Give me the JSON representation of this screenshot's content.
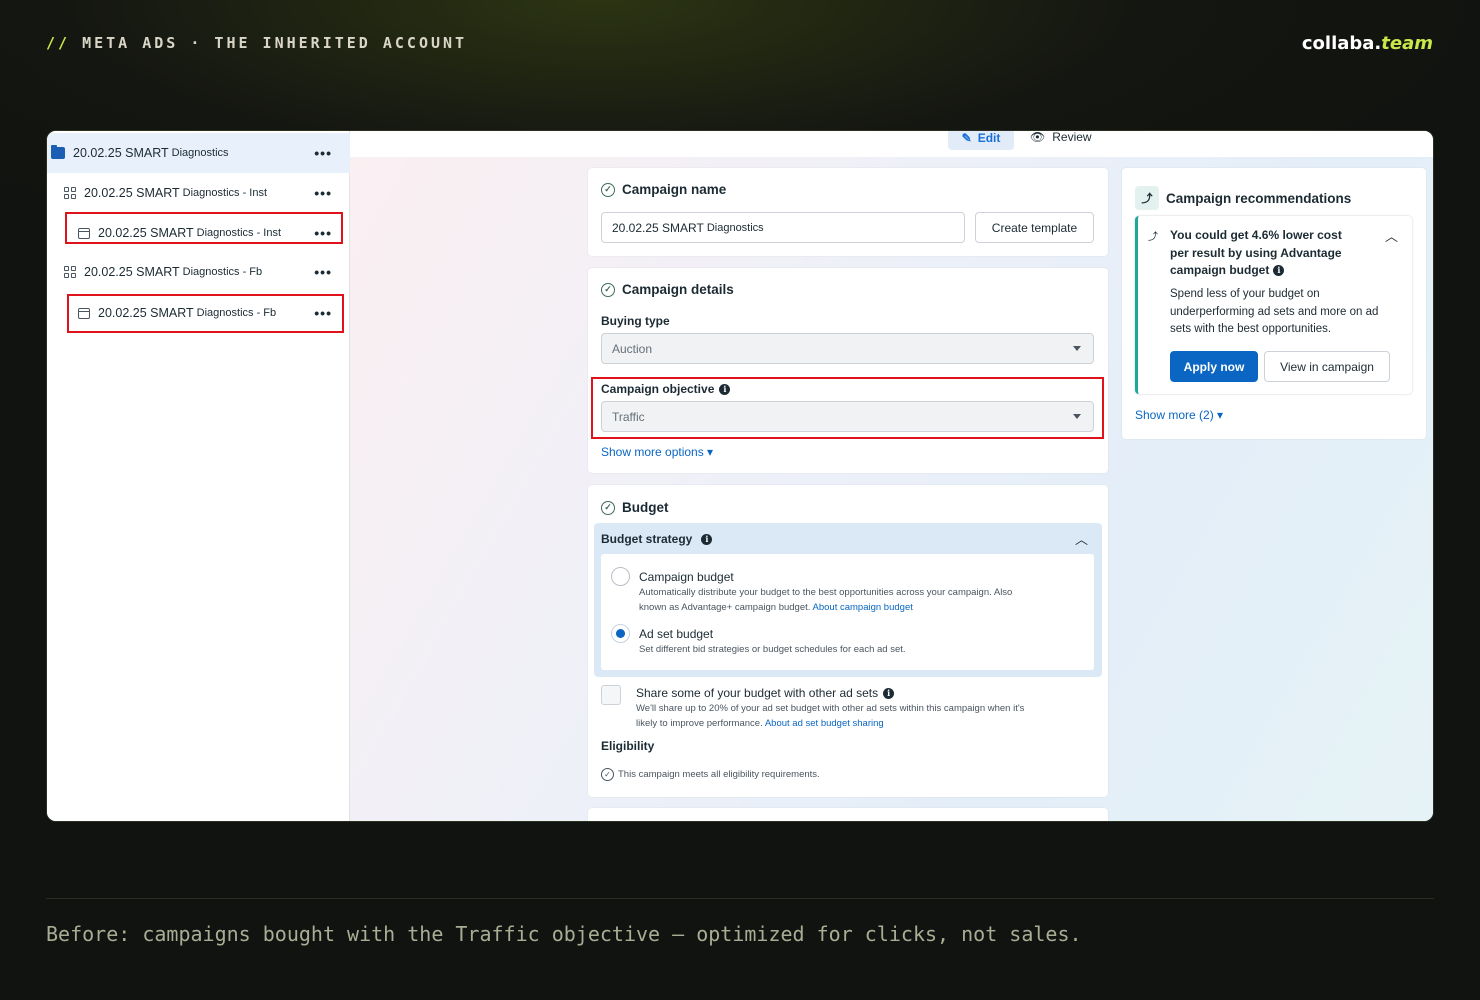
{
  "header": {
    "slashes": "//",
    "label": "META ADS · THE INHERITED ACCOUNT",
    "brand_main": "collaba.",
    "brand_accent": "team"
  },
  "sidebar": {
    "items": [
      {
        "strong": "20.02.25 SMART",
        "light": "Diagnostics",
        "icon": "folder-icon",
        "selected": true
      },
      {
        "strong": "20.02.25 SMART",
        "light": "Diagnostics - Inst",
        "icon": "adset-grid-icon"
      },
      {
        "strong": "20.02.25 SMART",
        "light": "Diagnostics - Inst",
        "icon": "ad-icon",
        "highlighted": true
      },
      {
        "strong": "20.02.25 SMART",
        "light": "Diagnostics - Fb",
        "icon": "adset-grid-icon"
      },
      {
        "strong": "20.02.25 SMART",
        "light": "Diagnostics - Fb",
        "icon": "ad-icon",
        "highlighted": true
      }
    ],
    "more_label": "•••"
  },
  "toolbar": {
    "edit_label": "Edit",
    "review_label": "Review"
  },
  "campaign_name": {
    "title": "Campaign name",
    "value_strong": "20.02.25 SMART",
    "value_light": "Diagnostics",
    "create_template": "Create template"
  },
  "campaign_details": {
    "title": "Campaign details",
    "buying_type_label": "Buying type",
    "buying_type_value": "Auction",
    "objective_label": "Campaign objective",
    "objective_value": "Traffic",
    "show_more": "Show more options ▾"
  },
  "budget": {
    "title": "Budget",
    "strategy_label": "Budget strategy",
    "options": [
      {
        "title": "Campaign budget",
        "desc1": "Automatically distribute your budget to the best opportunities across your campaign. Also",
        "desc2": "known as Advantage+ campaign budget.",
        "link": "About campaign budget",
        "selected": false
      },
      {
        "title": "Ad set budget",
        "desc1": "Set different bid strategies or budget schedules for each ad set.",
        "selected": true
      }
    ],
    "share_label": "Share some of your budget with other ad sets",
    "share_desc1": "We'll share up to 20% of your ad set budget with other ad sets within this campaign when it's",
    "share_desc2": "likely to improve performance.",
    "share_link": "About ad set budget sharing",
    "eligibility_label": "Eligibility",
    "eligibility_text": "This campaign meets all eligibility requirements."
  },
  "recommendations": {
    "title": "Campaign recommendations",
    "rec_title_1": "You could get 4.6% lower cost",
    "rec_title_2": "per result by using Advantage",
    "rec_title_3": "campaign budget",
    "rec_body_1": "Spend less of your budget on",
    "rec_body_2": "underperforming ad sets and more on ad",
    "rec_body_3": "sets with the best opportunities.",
    "apply": "Apply now",
    "view": "View in campaign",
    "show_more": "Show more (2) ▾"
  },
  "caption": "Before: campaigns bought with the Traffic objective — optimized for clicks, not sales.",
  "colors": {
    "accent": "#c9e84a",
    "highlight_red": "#e0121b",
    "meta_blue": "#0a66c2"
  }
}
